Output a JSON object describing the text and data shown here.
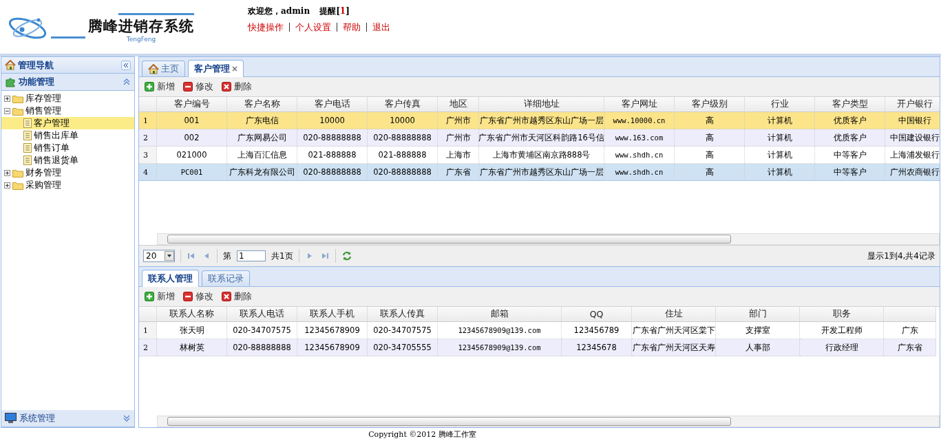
{
  "header": {
    "logo_title": "腾峰进销存系统",
    "logo_subtitle": "TengFeng",
    "welcome": "欢迎您，admin",
    "reminder_label": "提醒[",
    "reminder_count": "1",
    "reminder_end": "]",
    "links": [
      "快捷操作",
      "个人设置",
      "帮助",
      "退出"
    ]
  },
  "sidebar": {
    "title": "管理导航",
    "panels": [
      {
        "title": "功能管理",
        "expanded": true,
        "tree": [
          {
            "label": "库存管理",
            "kind": "folder",
            "expanded": false,
            "selected": false
          },
          {
            "label": "销售管理",
            "kind": "folder",
            "expanded": true,
            "selected": false,
            "children": [
              {
                "label": "客户管理",
                "kind": "page",
                "selected": true
              },
              {
                "label": "销售出库单",
                "kind": "page",
                "selected": false
              },
              {
                "label": "销售订单",
                "kind": "page",
                "selected": false
              },
              {
                "label": "销售退货单",
                "kind": "page",
                "selected": false
              }
            ]
          },
          {
            "label": "财务管理",
            "kind": "folder",
            "expanded": false,
            "selected": false
          },
          {
            "label": "采购管理",
            "kind": "folder",
            "expanded": false,
            "selected": false
          }
        ]
      },
      {
        "title": "系统管理",
        "expanded": false
      }
    ]
  },
  "main_tabs": [
    {
      "label": "主页",
      "kind": "home",
      "selected": false
    },
    {
      "label": "客户管理",
      "kind": "closable",
      "selected": true
    }
  ],
  "customer_toolbar": [
    {
      "label": "新增",
      "kind": "add"
    },
    {
      "label": "修改",
      "kind": "edit"
    },
    {
      "label": "删除",
      "kind": "delete"
    }
  ],
  "customer_table": {
    "columns": [
      "客户编号",
      "客户名称",
      "客户电话",
      "客户传真",
      "地区",
      "详细地址",
      "客户网址",
      "客户级别",
      "行业",
      "客户类型",
      "开户银行"
    ],
    "rows": [
      {
        "number": "1",
        "selected": true,
        "hovered": false,
        "cells": [
          "001",
          "广东电信",
          "10000",
          "10000",
          "广州市",
          "广东省广州市越秀区东山广场一层",
          "www.10000.cn",
          "高",
          "计算机",
          "优质客户",
          "中国银行"
        ]
      },
      {
        "number": "2",
        "selected": false,
        "hovered": false,
        "cells": [
          "002",
          "广东网易公司",
          "020-88888888",
          "020-88888888",
          "广州市",
          "广东省广州市天河区科韵路16号信",
          "www.163.com",
          "高",
          "计算机",
          "优质客户",
          "中国建设银行"
        ]
      },
      {
        "number": "3",
        "selected": false,
        "hovered": false,
        "cells": [
          "021000",
          "上海百汇信息",
          "021-888888",
          "021-888888",
          "上海市",
          "上海市黄埔区南京路888号",
          "www.shdh.cn",
          "高",
          "计算机",
          "中等客户",
          "上海浦发银行"
        ]
      },
      {
        "number": "4",
        "selected": false,
        "hovered": true,
        "cells": [
          "PC001",
          "广东科龙有限公司",
          "020-88888888",
          "020-88888888",
          "广东省",
          "广东省广州市越秀区东山广场一层",
          "www.shdh.cn",
          "高",
          "计算机",
          "中等客户",
          "广州农商银行"
        ]
      }
    ]
  },
  "pager": {
    "page_size": "20",
    "page_prefix": "第",
    "page": "1",
    "page_total": "共1页",
    "summary": "显示1到4,共4记录"
  },
  "detail_tabs": [
    {
      "label": "联系人管理",
      "selected": true
    },
    {
      "label": "联系记录",
      "selected": false
    }
  ],
  "contact_toolbar": [
    {
      "label": "新增",
      "kind": "add"
    },
    {
      "label": "修改",
      "kind": "edit"
    },
    {
      "label": "删除",
      "kind": "delete"
    }
  ],
  "contact_table": {
    "columns": [
      "联系人名称",
      "联系人电话",
      "联系人手机",
      "联系人传真",
      "邮箱",
      "QQ",
      "住址",
      "部门",
      "职务"
    ],
    "rows": [
      {
        "number": "1",
        "selected": false,
        "hovered": false,
        "cells": [
          "张天明",
          "020-34707575",
          "12345678909",
          "020-34707575",
          "12345678909@139.com",
          "123456789",
          "广东省广州天河区棠下",
          "支撑室",
          "开发工程师",
          "广东"
        ]
      },
      {
        "number": "2",
        "selected": false,
        "hovered": false,
        "cells": [
          "林树英",
          "020-88888888",
          "12345678909",
          "020-34705555",
          "12345678909@139.com",
          "12345678",
          "广东省广州天河区天寿",
          "人事部",
          "行政经理",
          "广东省"
        ]
      }
    ]
  },
  "footer": "Copyright ©2012 腾峰工作室"
}
